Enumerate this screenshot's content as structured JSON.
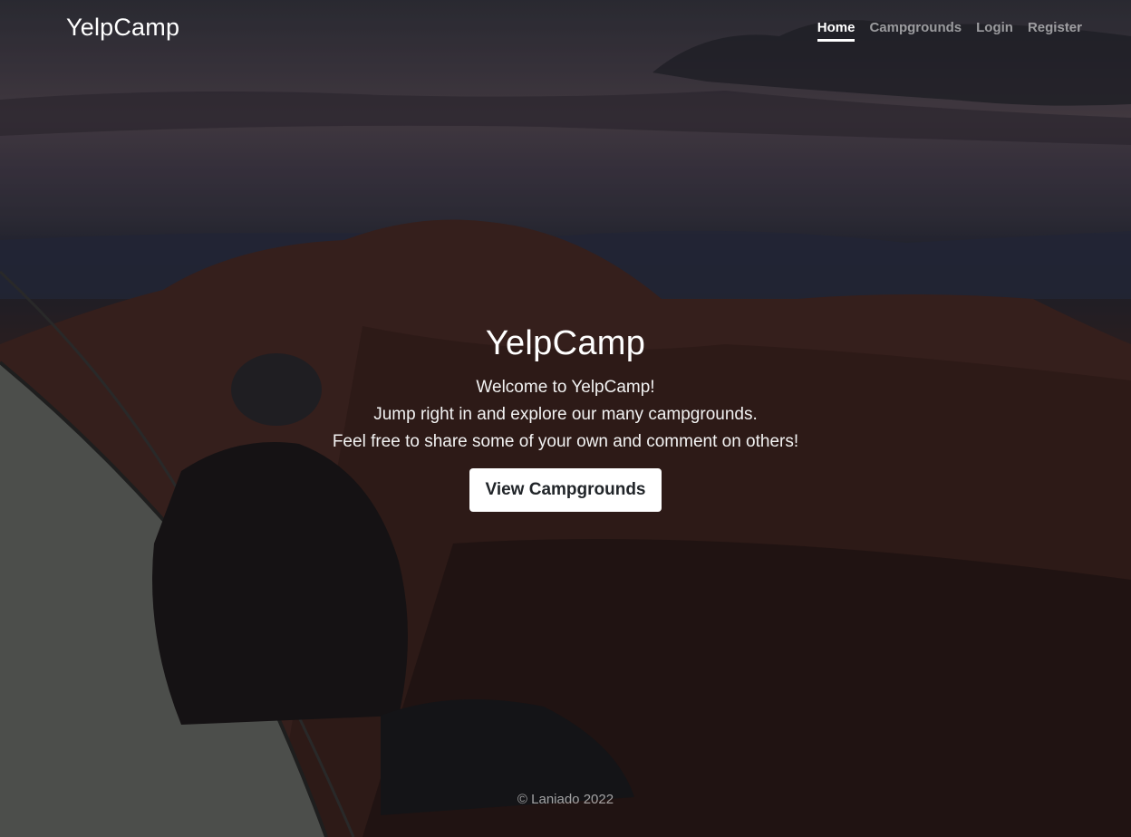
{
  "header": {
    "brand": "YelpCamp",
    "nav": [
      {
        "label": "Home",
        "active": true
      },
      {
        "label": "Campgrounds",
        "active": false
      },
      {
        "label": "Login",
        "active": false
      },
      {
        "label": "Register",
        "active": false
      }
    ]
  },
  "hero": {
    "title": "YelpCamp",
    "lines": [
      "Welcome to YelpCamp!",
      "Jump right in and explore our many campgrounds.",
      "Feel free to share some of your own and comment on others!"
    ],
    "cta_label": "View Campgrounds"
  },
  "footer": {
    "text": "© Laniado 2022"
  },
  "colors": {
    "nav_active": "#ffffff",
    "nav_inactive": "#8c8c8c",
    "cta_bg": "#ffffff",
    "cta_text": "#212529"
  }
}
